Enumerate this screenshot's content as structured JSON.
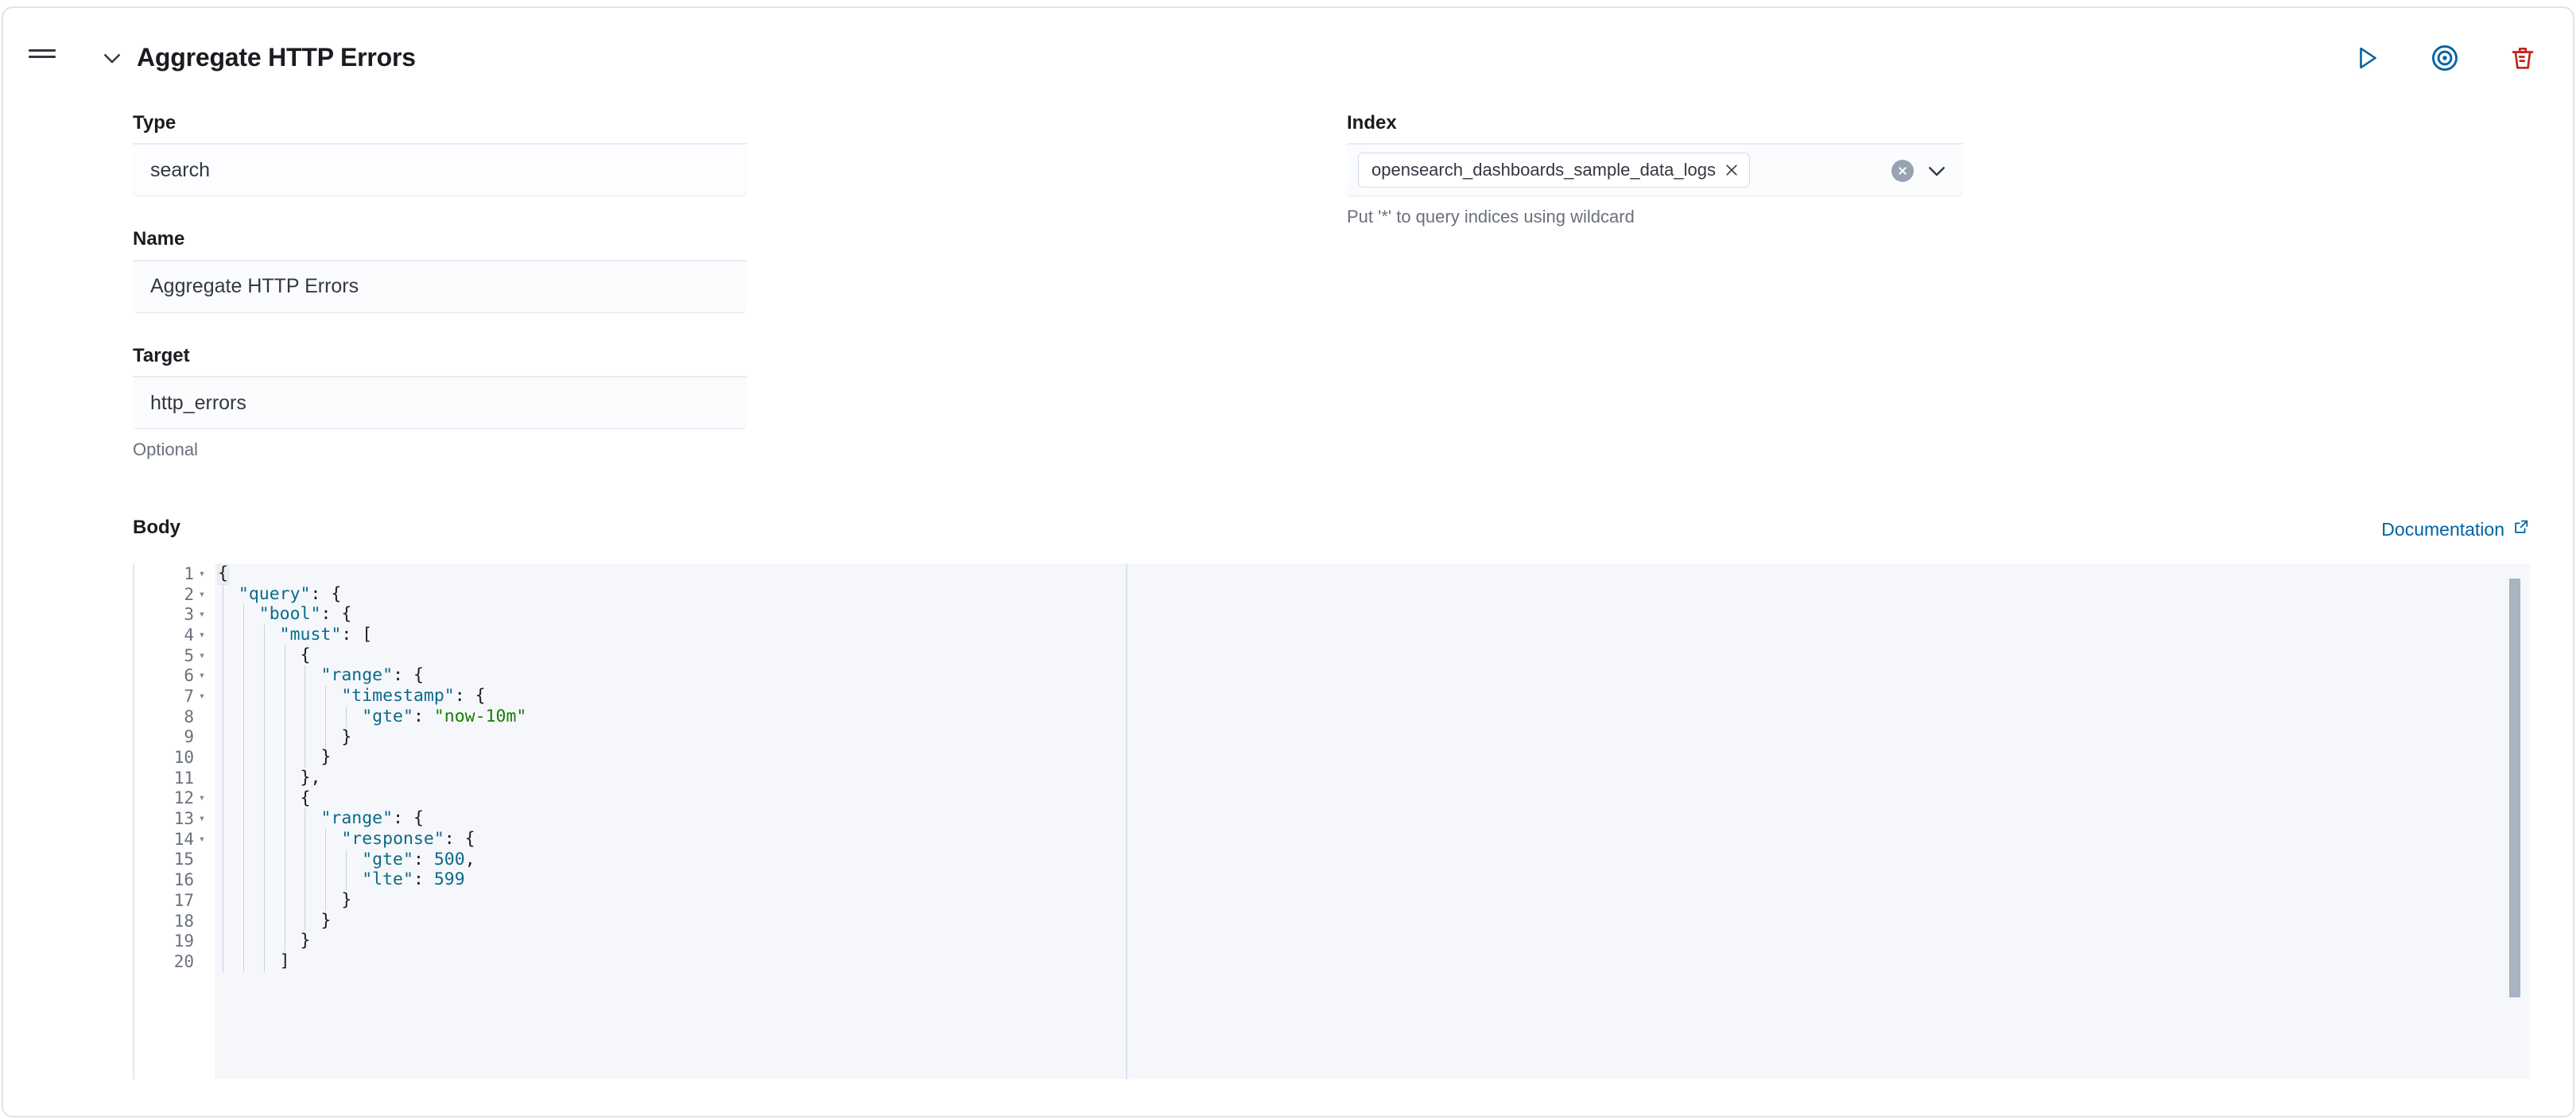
{
  "panel": {
    "title": "Aggregate HTTP Errors",
    "drag_handle_icon": "drag-handle-icon",
    "collapse_icon": "chevron-down-icon",
    "actions": [
      {
        "name": "run-button",
        "icon": "play-triangle-icon",
        "color": "#0061a4",
        "label": "Run"
      },
      {
        "name": "target-button",
        "icon": "bullseye-target-icon",
        "color": "#0061a4",
        "label": "Target"
      },
      {
        "name": "delete-button",
        "icon": "trash-icon",
        "color": "#bd271e",
        "label": "Delete"
      }
    ]
  },
  "form": {
    "type": {
      "label": "Type",
      "value": "search"
    },
    "name": {
      "label": "Name",
      "value": "Aggregate HTTP Errors"
    },
    "target": {
      "label": "Target",
      "value": "http_errors",
      "hint": "Optional"
    },
    "index": {
      "label": "Index",
      "hint": "Put '*' to query indices using wildcard",
      "selected": [
        "opensearch_dashboards_sample_data_logs"
      ],
      "pill_remove_icon": "cross-icon",
      "clear_icon": "clear-circle-icon",
      "caret_icon": "chevron-down-icon"
    }
  },
  "body": {
    "label": "Body",
    "documentation_label": "Documentation",
    "documentation_icon": "external-link-icon",
    "editor": {
      "language": "json",
      "total_lines": 20,
      "first_visible_line": 1,
      "last_visible_line": 20,
      "cursor_line": 1,
      "scrollbar_visible": true,
      "lines": [
        {
          "n": 1,
          "foldable": true,
          "indent": 0,
          "text": "{"
        },
        {
          "n": 2,
          "foldable": true,
          "indent": 1,
          "text": "\"query\": {",
          "key": "\"query\""
        },
        {
          "n": 3,
          "foldable": true,
          "indent": 2,
          "text": "\"bool\": {",
          "key": "\"bool\""
        },
        {
          "n": 4,
          "foldable": true,
          "indent": 3,
          "text": "\"must\": [",
          "key": "\"must\""
        },
        {
          "n": 5,
          "foldable": true,
          "indent": 4,
          "text": "{"
        },
        {
          "n": 6,
          "foldable": true,
          "indent": 5,
          "text": "\"range\": {",
          "key": "\"range\""
        },
        {
          "n": 7,
          "foldable": true,
          "indent": 6,
          "text": "\"timestamp\": {",
          "key": "\"timestamp\""
        },
        {
          "n": 8,
          "foldable": false,
          "indent": 7,
          "text": "\"gte\": \"now-10m\"",
          "key": "\"gte\"",
          "string": "\"now-10m\""
        },
        {
          "n": 9,
          "foldable": false,
          "indent": 6,
          "text": "}"
        },
        {
          "n": 10,
          "foldable": false,
          "indent": 5,
          "text": "}"
        },
        {
          "n": 11,
          "foldable": false,
          "indent": 4,
          "text": "},"
        },
        {
          "n": 12,
          "foldable": true,
          "indent": 4,
          "text": "{"
        },
        {
          "n": 13,
          "foldable": true,
          "indent": 5,
          "text": "\"range\": {",
          "key": "\"range\""
        },
        {
          "n": 14,
          "foldable": true,
          "indent": 6,
          "text": "\"response\": {",
          "key": "\"response\""
        },
        {
          "n": 15,
          "foldable": false,
          "indent": 7,
          "text": "\"gte\": 500,",
          "key": "\"gte\"",
          "number": "500"
        },
        {
          "n": 16,
          "foldable": false,
          "indent": 7,
          "text": "\"lte\": 599",
          "key": "\"lte\"",
          "number": "599"
        },
        {
          "n": 17,
          "foldable": false,
          "indent": 6,
          "text": "}"
        },
        {
          "n": 18,
          "foldable": false,
          "indent": 5,
          "text": "}"
        },
        {
          "n": 19,
          "foldable": false,
          "indent": 4,
          "text": "}"
        },
        {
          "n": 20,
          "foldable": false,
          "indent": 3,
          "text": "]"
        }
      ]
    }
  },
  "colors": {
    "accent_link": "#0061a4",
    "danger": "#bd271e",
    "text_primary": "#1a1c21",
    "text_muted": "#69707d",
    "editor_bg": "#f5f7fa",
    "json_key": "#0b6a8a",
    "json_string": "#197d00",
    "panel_border": "#dfe3ed"
  }
}
